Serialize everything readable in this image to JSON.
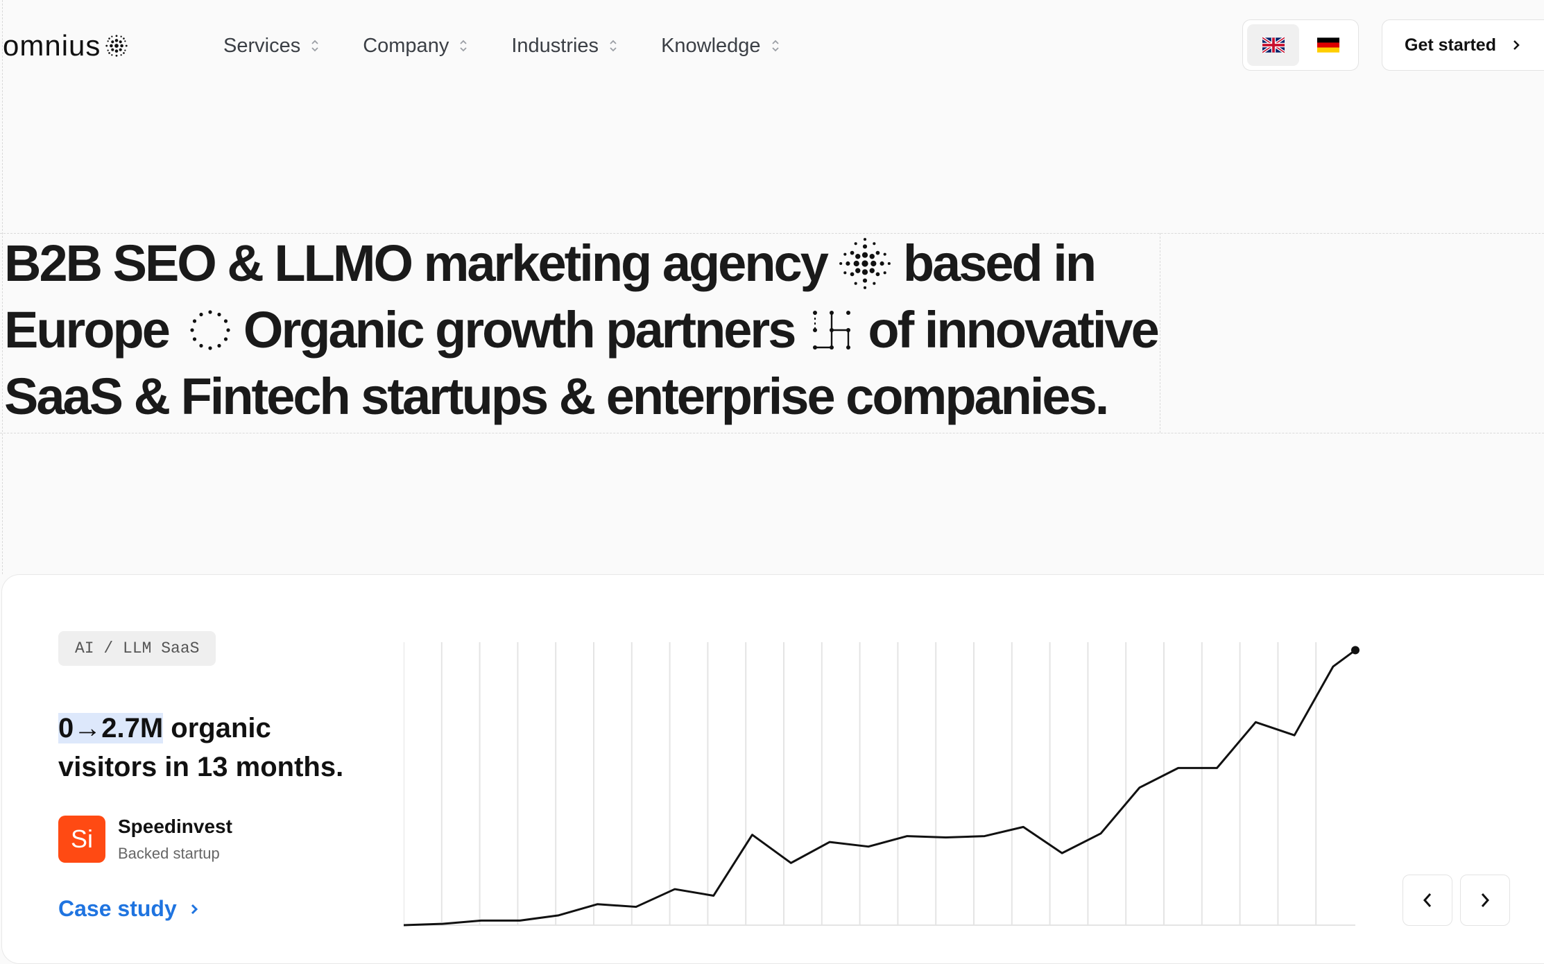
{
  "brand": {
    "logo_text": "omnius"
  },
  "nav": {
    "items": [
      {
        "label": "Services"
      },
      {
        "label": "Company"
      },
      {
        "label": "Industries"
      },
      {
        "label": "Knowledge"
      }
    ]
  },
  "language": {
    "options": [
      "English",
      "Deutsch"
    ],
    "selected": "English"
  },
  "cta": {
    "label": "Get started"
  },
  "hero": {
    "line1_a": "B2B SEO & LLMO marketing agency",
    "line1_b": "based in",
    "line2_a": "Europe",
    "line2_b": "Organic growth partners",
    "line2_c": "of innovative",
    "line3": "SaaS & Fintech startups & enterprise companies."
  },
  "case": {
    "tag": "AI / LLM SaaS",
    "headline_highlight": "0→2.7M",
    "headline_rest_1": " organic",
    "headline_rest_2": "visitors in 13 months.",
    "company_initials": "Si",
    "company_name": "Speedinvest",
    "company_sub": "Backed startup",
    "link_label": "Case study"
  },
  "colors": {
    "accent": "#1f74e0",
    "company": "#ff4a13",
    "highlight": "#dde8fb"
  },
  "chart_data": {
    "type": "line",
    "x": [
      1,
      2,
      3,
      4,
      5,
      6,
      7,
      8,
      9,
      10,
      11,
      12,
      13,
      14,
      15,
      16,
      17,
      18,
      19,
      20,
      21,
      22,
      23,
      24,
      25
    ],
    "values": [
      0,
      0.02,
      0.07,
      0.07,
      0.15,
      0.32,
      0.28,
      0.55,
      0.45,
      1.38,
      0.95,
      1.27,
      1.2,
      1.36,
      1.34,
      1.36,
      1.5,
      1.1,
      1.4,
      2.1,
      2.4,
      2.4,
      3.1,
      2.9,
      3.95,
      4.2
    ],
    "ylim": [
      0,
      4.3
    ],
    "grid": "vertical",
    "title": "",
    "xlabel": "",
    "ylabel": ""
  }
}
